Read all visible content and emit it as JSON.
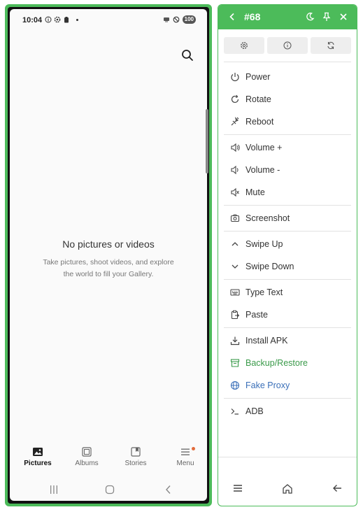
{
  "phone": {
    "status": {
      "time": "10:04",
      "battery": "100"
    },
    "empty_title": "No pictures or videos",
    "empty_subtitle": "Take pictures, shoot videos, and explore the world to fill your Gallery.",
    "nav": [
      {
        "label": "Pictures",
        "icon": "picture-icon",
        "active": true
      },
      {
        "label": "Albums",
        "icon": "album-icon",
        "active": false
      },
      {
        "label": "Stories",
        "icon": "stories-icon",
        "active": false
      },
      {
        "label": "Menu",
        "icon": "menu-icon",
        "active": false
      }
    ],
    "colors": {
      "badge": "#e26b3b"
    }
  },
  "panel": {
    "title": "#68",
    "accent": "#4cbb5a",
    "header_icons": [
      "back-icon",
      "moon-icon",
      "pin-icon",
      "close-icon"
    ],
    "tool_buttons": [
      "settings-icon",
      "info-icon",
      "refresh-icon"
    ],
    "groups": [
      [
        {
          "label": "Power",
          "icon": "power-icon"
        },
        {
          "label": "Rotate",
          "icon": "rotate-icon"
        },
        {
          "label": "Reboot",
          "icon": "reboot-icon"
        }
      ],
      [
        {
          "label": "Volume +",
          "icon": "volume-up-icon"
        },
        {
          "label": "Volume -",
          "icon": "volume-down-icon"
        },
        {
          "label": "Mute",
          "icon": "mute-icon"
        }
      ],
      [
        {
          "label": "Screenshot",
          "icon": "camera-icon"
        }
      ],
      [
        {
          "label": "Swipe Up",
          "icon": "chevron-up-icon"
        },
        {
          "label": "Swipe Down",
          "icon": "chevron-down-icon"
        }
      ],
      [
        {
          "label": "Type Text",
          "icon": "keyboard-icon"
        },
        {
          "label": "Paste",
          "icon": "paste-icon"
        }
      ],
      [
        {
          "label": "Install APK",
          "icon": "download-icon"
        },
        {
          "label": "Backup/Restore",
          "icon": "archive-icon",
          "color": "#3a9a4a"
        },
        {
          "label": "Fake Proxy",
          "icon": "globe-icon",
          "color": "#3a6fb8"
        }
      ],
      [
        {
          "label": "ADB",
          "icon": "terminal-icon"
        }
      ]
    ],
    "footer_icons": [
      "hamburger-icon",
      "home-icon",
      "arrow-left-icon"
    ]
  }
}
